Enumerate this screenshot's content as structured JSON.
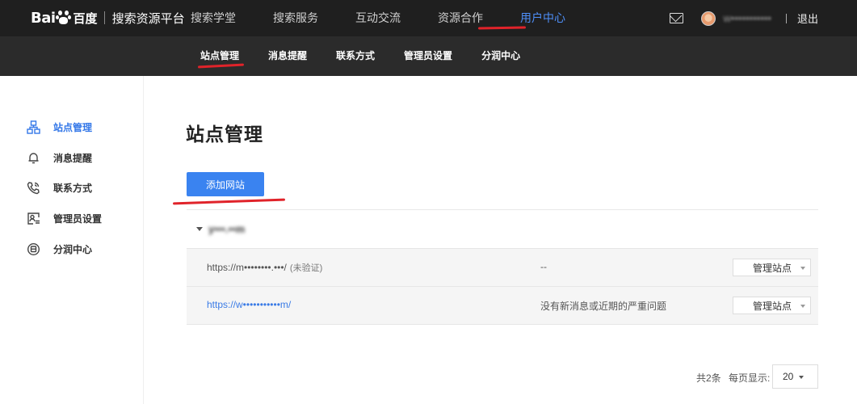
{
  "header": {
    "logo_text": "Bai",
    "logo_cn": "百度",
    "logo_sub": "搜索资源平台",
    "nav": [
      "搜索学堂",
      "搜索服务",
      "互动交流",
      "资源合作",
      "用户中心"
    ],
    "active_nav": "用户中心",
    "username": "w•••••••••••",
    "logout": "退出"
  },
  "subnav": [
    "站点管理",
    "消息提醒",
    "联系方式",
    "管理员设置",
    "分润中心"
  ],
  "sidebar": [
    {
      "label": "站点管理",
      "icon": "sitemap-icon",
      "active": true
    },
    {
      "label": "消息提醒",
      "icon": "bell-icon",
      "active": false
    },
    {
      "label": "联系方式",
      "icon": "phone-icon",
      "active": false
    },
    {
      "label": "管理员设置",
      "icon": "admin-card-icon",
      "active": false
    },
    {
      "label": "分润中心",
      "icon": "revenue-icon",
      "active": false
    }
  ],
  "main": {
    "title": "站点管理",
    "add_button": "添加网站",
    "group_name": "y•••.••m",
    "rows": [
      {
        "url": "https://m••••••••.•••/",
        "status": "(未验证)",
        "message": "--",
        "action": "管理站点"
      },
      {
        "url": "https://w•••••••••••m/",
        "status": "",
        "message": "没有新消息或近期的严重问题",
        "action": "管理站点"
      }
    ]
  },
  "pagination": {
    "total": "共2条",
    "per_page_label": "每页显示:",
    "per_page": "20"
  },
  "colors": {
    "accent": "#3a83f0",
    "topbar": "#1f1f1f",
    "subbar": "#2b2b2b",
    "annotation_red": "#e0232a"
  }
}
